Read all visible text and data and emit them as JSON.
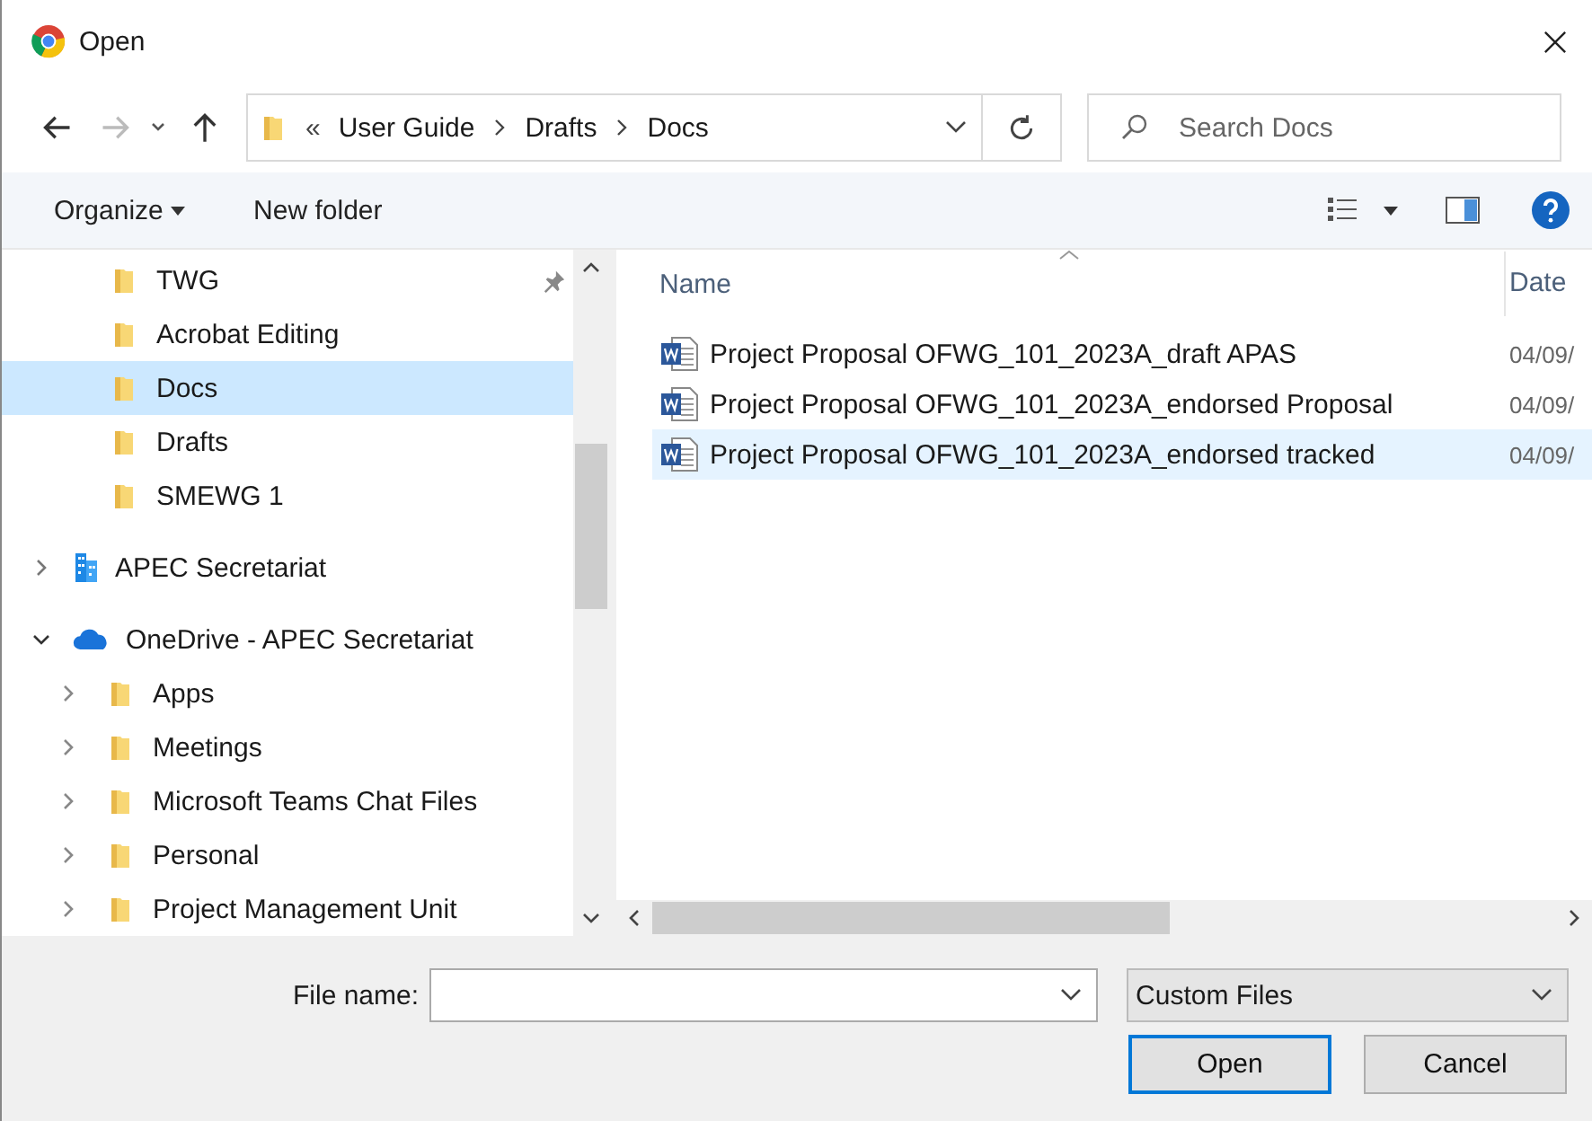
{
  "window": {
    "title": "Open"
  },
  "address_bar": {
    "crumbs": [
      "User Guide",
      "Drafts",
      "Docs"
    ],
    "overflow": "«"
  },
  "search": {
    "placeholder": "Search Docs"
  },
  "toolbar": {
    "organize": "Organize",
    "new_folder": "New folder"
  },
  "quick_access": [
    {
      "label": "TWG",
      "pinned": true,
      "selected": false
    },
    {
      "label": "Acrobat Editing",
      "pinned": false,
      "selected": false
    },
    {
      "label": "Docs",
      "pinned": false,
      "selected": true
    },
    {
      "label": "Drafts",
      "pinned": false,
      "selected": false
    },
    {
      "label": "SMEWG 1",
      "pinned": false,
      "selected": false
    }
  ],
  "locations": [
    {
      "label": "APEC Secretariat",
      "kind": "organization",
      "expanded": false
    },
    {
      "label": "OneDrive - APEC Secretariat",
      "kind": "cloud",
      "expanded": true,
      "children": [
        {
          "label": "Apps",
          "kind": "folder",
          "expanded": false
        },
        {
          "label": "Meetings",
          "kind": "folder",
          "expanded": false
        },
        {
          "label": "Microsoft Teams Chat Files",
          "kind": "folder",
          "expanded": false
        },
        {
          "label": "Personal",
          "kind": "folder",
          "expanded": false
        },
        {
          "label": "Project Management Unit",
          "kind": "folder",
          "expanded": false
        }
      ]
    }
  ],
  "file_list": {
    "columns": [
      "Name",
      "Date"
    ],
    "rows": [
      {
        "name": "Project Proposal OFWG_101_2023A_draft APAS",
        "date": "04/09/",
        "selected": false
      },
      {
        "name": "Project Proposal OFWG_101_2023A_endorsed Proposal",
        "date": "04/09/",
        "selected": false
      },
      {
        "name": "Project Proposal OFWG_101_2023A_endorsed tracked",
        "date": "04/09/",
        "selected": true
      }
    ]
  },
  "footer": {
    "file_name_label": "File name:",
    "file_type": "Custom Files",
    "buttons": [
      "Open",
      "Cancel"
    ]
  }
}
